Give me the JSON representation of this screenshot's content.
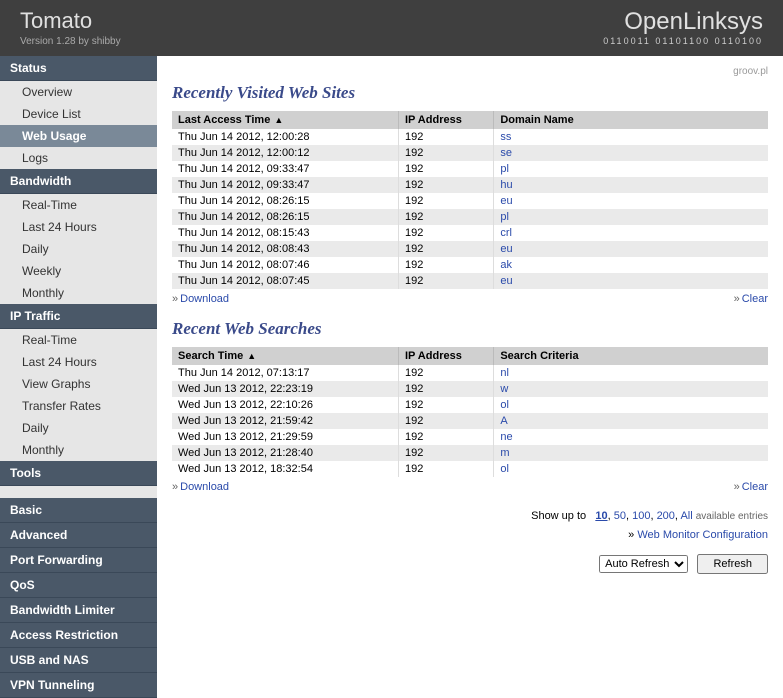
{
  "header": {
    "title": "Tomato",
    "version": "Version 1.28 by shibby",
    "brand": "OpenLinksys",
    "binary": "0110011 01101100 0110100"
  },
  "topLink": "groov.pl",
  "sidebar": [
    {
      "type": "section",
      "label": "Status"
    },
    {
      "type": "item",
      "label": "Overview"
    },
    {
      "type": "item",
      "label": "Device List"
    },
    {
      "type": "item",
      "label": "Web Usage",
      "active": true
    },
    {
      "type": "item",
      "label": "Logs"
    },
    {
      "type": "section",
      "label": "Bandwidth"
    },
    {
      "type": "item",
      "label": "Real-Time"
    },
    {
      "type": "item",
      "label": "Last 24 Hours"
    },
    {
      "type": "item",
      "label": "Daily"
    },
    {
      "type": "item",
      "label": "Weekly"
    },
    {
      "type": "item",
      "label": "Monthly"
    },
    {
      "type": "section",
      "label": "IP Traffic"
    },
    {
      "type": "item",
      "label": "Real-Time"
    },
    {
      "type": "item",
      "label": "Last 24 Hours"
    },
    {
      "type": "item",
      "label": "View Graphs"
    },
    {
      "type": "item",
      "label": "Transfer Rates"
    },
    {
      "type": "item",
      "label": "Daily"
    },
    {
      "type": "item",
      "label": "Monthly"
    },
    {
      "type": "section",
      "label": "Tools"
    },
    {
      "type": "spacer"
    },
    {
      "type": "section",
      "label": "Basic"
    },
    {
      "type": "section",
      "label": "Advanced"
    },
    {
      "type": "section",
      "label": "Port Forwarding"
    },
    {
      "type": "section",
      "label": "QoS"
    },
    {
      "type": "section",
      "label": "Bandwidth Limiter"
    },
    {
      "type": "section",
      "label": "Access Restriction"
    },
    {
      "type": "section",
      "label": "USB and NAS"
    },
    {
      "type": "section",
      "label": "VPN Tunneling"
    }
  ],
  "visited": {
    "title": "Recently Visited Web Sites",
    "headers": {
      "time": "Last Access Time",
      "ip": "IP Address",
      "domain": "Domain Name"
    },
    "rows": [
      {
        "time": "Thu Jun 14 2012, 12:00:28",
        "ip": "192",
        "domain": "ss"
      },
      {
        "time": "Thu Jun 14 2012, 12:00:12",
        "ip": "192",
        "domain": "se"
      },
      {
        "time": "Thu Jun 14 2012, 09:33:47",
        "ip": "192",
        "domain": "pl"
      },
      {
        "time": "Thu Jun 14 2012, 09:33:47",
        "ip": "192",
        "domain": "hu"
      },
      {
        "time": "Thu Jun 14 2012, 08:26:15",
        "ip": "192",
        "domain": "eu"
      },
      {
        "time": "Thu Jun 14 2012, 08:26:15",
        "ip": "192",
        "domain": "pl"
      },
      {
        "time": "Thu Jun 14 2012, 08:15:43",
        "ip": "192",
        "domain": "crl"
      },
      {
        "time": "Thu Jun 14 2012, 08:08:43",
        "ip": "192",
        "domain": "eu"
      },
      {
        "time": "Thu Jun 14 2012, 08:07:46",
        "ip": "192",
        "domain": "ak"
      },
      {
        "time": "Thu Jun 14 2012, 08:07:45",
        "ip": "192",
        "domain": "eu"
      }
    ]
  },
  "searches": {
    "title": "Recent Web Searches",
    "headers": {
      "time": "Search Time",
      "ip": "IP Address",
      "criteria": "Search Criteria"
    },
    "rows": [
      {
        "time": "Thu Jun 14 2012, 07:13:17",
        "ip": "192",
        "criteria": "nl"
      },
      {
        "time": "Wed Jun 13 2012, 22:23:19",
        "ip": "192",
        "criteria": "w"
      },
      {
        "time": "Wed Jun 13 2012, 22:10:26",
        "ip": "192",
        "criteria": "ol"
      },
      {
        "time": "Wed Jun 13 2012, 21:59:42",
        "ip": "192",
        "criteria": "A"
      },
      {
        "time": "Wed Jun 13 2012, 21:29:59",
        "ip": "192",
        "criteria": "ne"
      },
      {
        "time": "Wed Jun 13 2012, 21:28:40",
        "ip": "192",
        "criteria": "m"
      },
      {
        "time": "Wed Jun 13 2012, 18:32:54",
        "ip": "192",
        "criteria": "ol"
      }
    ]
  },
  "links": {
    "download": "Download",
    "clear": "Clear"
  },
  "showup": {
    "label": "Show up to",
    "opts": [
      "10",
      "50",
      "100",
      "200",
      "All"
    ],
    "trail": "available entries"
  },
  "config": "Web Monitor Configuration",
  "refresh": {
    "select": "Auto Refresh",
    "button": "Refresh"
  }
}
